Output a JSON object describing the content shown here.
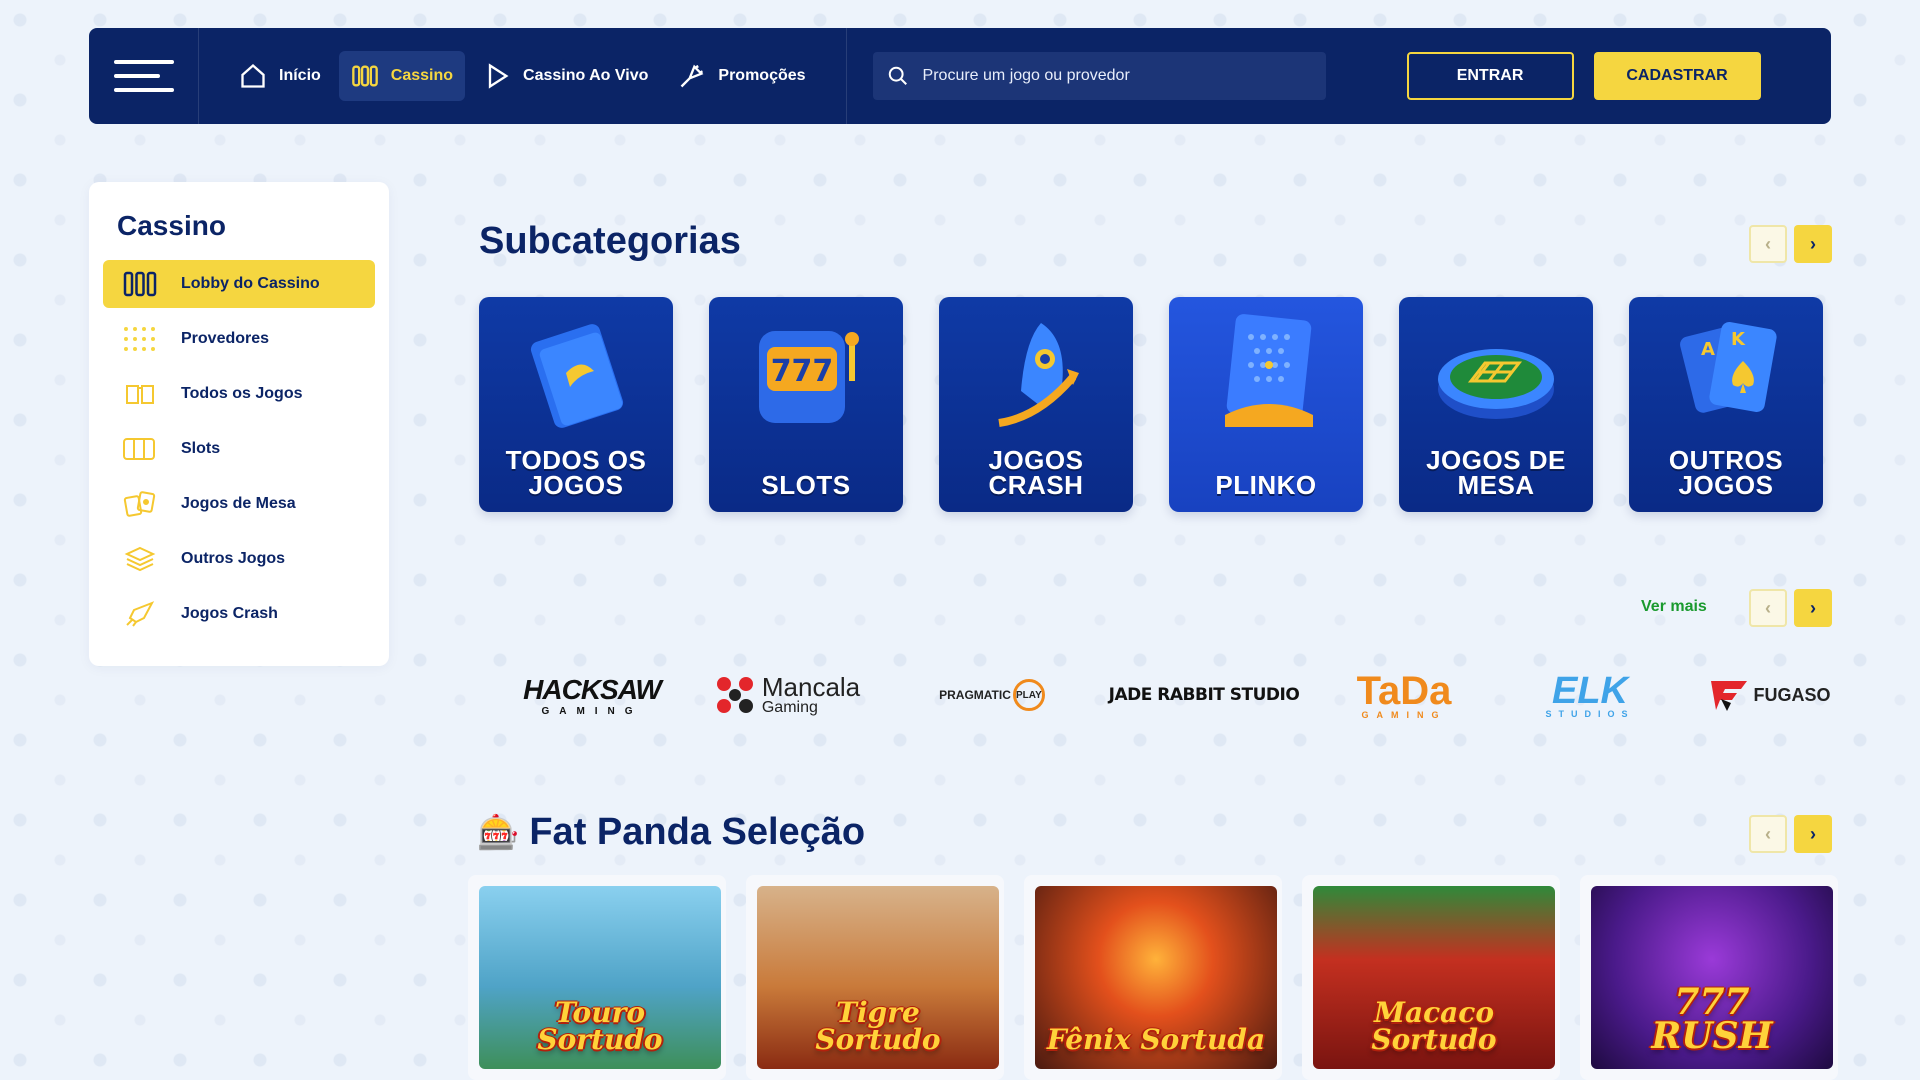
{
  "header": {
    "nav": [
      {
        "label": "Início",
        "icon": "home-icon"
      },
      {
        "label": "Cassino",
        "icon": "casino-icon",
        "active": true
      },
      {
        "label": "Cassino Ao Vivo",
        "icon": "play-icon"
      },
      {
        "label": "Promoções",
        "icon": "promo-icon"
      }
    ],
    "search_placeholder": "Procure um jogo ou provedor",
    "login_label": "ENTRAR",
    "register_label": "CADASTRAR"
  },
  "sidebar": {
    "title": "Cassino",
    "items": [
      {
        "label": "Lobby do Cassino",
        "icon": "lobby-icon",
        "active": true
      },
      {
        "label": "Provedores",
        "icon": "grid-dots-icon"
      },
      {
        "label": "Todos os Jogos",
        "icon": "book-icon"
      },
      {
        "label": "Slots",
        "icon": "slots-icon"
      },
      {
        "label": "Jogos de Mesa",
        "icon": "cards-icon"
      },
      {
        "label": "Outros Jogos",
        "icon": "layers-icon"
      },
      {
        "label": "Jogos Crash",
        "icon": "rocket-icon"
      }
    ]
  },
  "subcategories": {
    "title": "Subcategorias",
    "items": [
      {
        "label_line1": "TODOS OS",
        "label_line2": "JOGOS",
        "icon": "book-icon"
      },
      {
        "label_line1": "",
        "label_line2": "SLOTS",
        "icon": "slot-machine-icon"
      },
      {
        "label_line1": "JOGOS",
        "label_line2": "CRASH",
        "icon": "rocket-icon"
      },
      {
        "label_line1": "",
        "label_line2": "PLINKO",
        "icon": "plinko-icon"
      },
      {
        "label_line1": "JOGOS DE",
        "label_line2": "MESA",
        "icon": "table-icon"
      },
      {
        "label_line1": "OUTROS",
        "label_line2": "JOGOS",
        "icon": "cards-icon"
      }
    ]
  },
  "providers": {
    "see_more_label": "Ver mais",
    "items": [
      {
        "name": "HACKSAW",
        "sub": "GAMING"
      },
      {
        "name": "Mancala",
        "sub": "Gaming"
      },
      {
        "name": "PRAGMATIC",
        "sub": "PLAY"
      },
      {
        "name": "JADE RABBIT STUDIO",
        "sub": ""
      },
      {
        "name": "TaDa",
        "sub": "GAMING"
      },
      {
        "name": "ELK",
        "sub": "STUDIOS"
      },
      {
        "name": "FUGASO",
        "sub": ""
      }
    ]
  },
  "selection": {
    "emoji": "🎰",
    "title": "Fat Panda Seleção",
    "games": [
      {
        "line1": "Touro",
        "line2": "Sortudo",
        "bg": "#4fa3c7"
      },
      {
        "line1": "Tigre",
        "line2": "Sortudo",
        "bg": "#c97a3a"
      },
      {
        "line1": "",
        "line2": "Fênix Sortuda",
        "bg": "#7a3a24"
      },
      {
        "line1": "Macaco",
        "line2": "Sortudo",
        "bg": "#c43020"
      },
      {
        "line1": "777",
        "line2": "RUSH",
        "bg": "#4a1a8a"
      }
    ]
  }
}
